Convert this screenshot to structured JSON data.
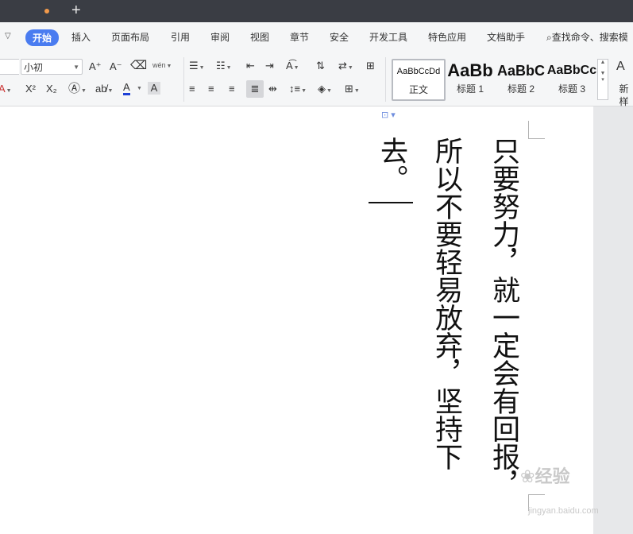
{
  "titlebar": {
    "new_tab": "+"
  },
  "menubar": {
    "items": [
      "开始",
      "插入",
      "页面布局",
      "引用",
      "审阅",
      "视图",
      "章节",
      "安全",
      "开发工具",
      "特色应用",
      "文档助手"
    ],
    "search_label": "查找命令、搜索模"
  },
  "ribbon": {
    "font_size": "小初",
    "grow_font": "A⁺",
    "shrink_font": "A⁻",
    "pinyin": "wén",
    "superscript": "X²",
    "subscript": "X₂",
    "styles": [
      {
        "sample": "AaBbCcDd",
        "name": "正文"
      },
      {
        "sample": "AaBb",
        "name": "标题 1"
      },
      {
        "sample": "AaBbC",
        "name": "标题 2"
      },
      {
        "sample": "AaBbCc",
        "name": "标题 3"
      }
    ],
    "new_style": "新样"
  },
  "document": {
    "columns": [
      "只要努力，就一定会有回报，",
      "所以不要轻易放弃，坚持下",
      "去。"
    ]
  },
  "watermark": {
    "brand": "经验",
    "url": "jingyan.baidu.com"
  }
}
